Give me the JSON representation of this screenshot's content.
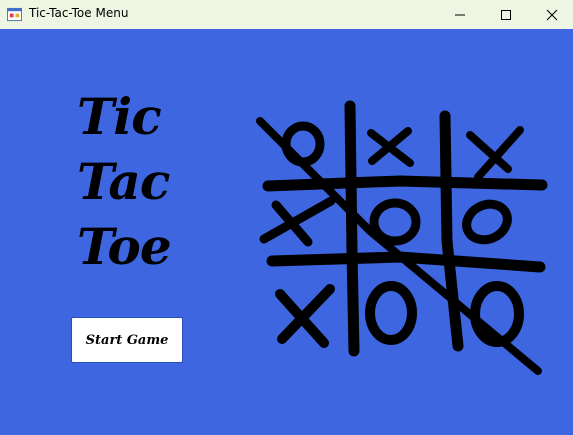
{
  "window": {
    "title": "Tic-Tac-Toe Menu",
    "controls": [
      "minimize",
      "maximize",
      "close"
    ]
  },
  "menu": {
    "title_lines": [
      "Tic",
      "Tac",
      "Toe"
    ],
    "start_button_label": "Start Game"
  },
  "board_image": {
    "cells": [
      [
        "O",
        "X",
        "X"
      ],
      [
        "X",
        "O",
        "O"
      ],
      [
        "X",
        "O",
        "O"
      ]
    ],
    "win_line": "diagonal top-left to bottom-right"
  },
  "colors": {
    "background": "#3d66e0",
    "titlebar": "#eef6e3",
    "ink": "#000000",
    "button_bg": "#ffffff"
  }
}
